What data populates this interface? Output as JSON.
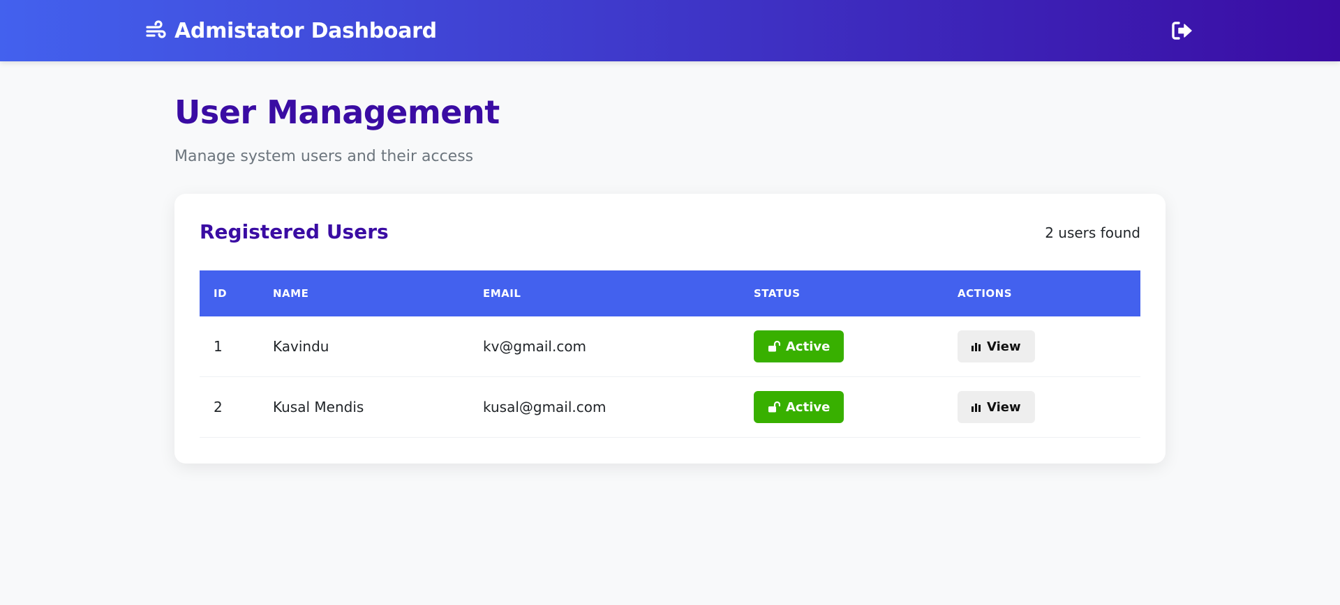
{
  "header": {
    "brand_icon": "wind-icon",
    "title": "Admistator Dashboard",
    "logout_icon": "sign-out-icon"
  },
  "page": {
    "title": "User Management",
    "subtitle": "Manage system users and their access"
  },
  "card": {
    "title": "Registered Users",
    "count_text": "2 users found"
  },
  "table": {
    "columns": [
      "ID",
      "NAME",
      "EMAIL",
      "STATUS",
      "ACTIONS"
    ],
    "rows": [
      {
        "id": "1",
        "name": "Kavindu",
        "email": "kv@gmail.com",
        "status": "Active",
        "action": "View"
      },
      {
        "id": "2",
        "name": "Kusal Mendis",
        "email": "kusal@gmail.com",
        "status": "Active",
        "action": "View"
      }
    ]
  },
  "colors": {
    "header_gradient_start": "#4361ee",
    "header_gradient_end": "#3a0ca3",
    "accent": "#3a0ca3",
    "table_header": "#4361ee",
    "status_active": "#38b000",
    "view_button": "#eeeeee"
  }
}
